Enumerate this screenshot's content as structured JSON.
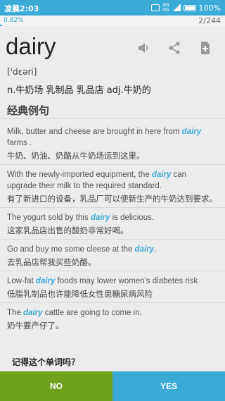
{
  "status": {
    "time": "凌晨2:03",
    "network": "4G",
    "network_sub": "3G",
    "battery": "100%"
  },
  "progress": {
    "percent_label": "0.82%",
    "fraction": 0.0082,
    "count": "2/244"
  },
  "word": {
    "text": "dairy",
    "phonetic": "['dɛəri]",
    "meaning": "n.牛奶场 乳制品 乳品店 adj.牛奶的"
  },
  "icons": {
    "speaker": "speaker-icon",
    "share": "share-icon",
    "add": "add-note-icon"
  },
  "section_title": "经典例句",
  "examples": [
    {
      "pre": "Milk, butter and cheese are brought in here from ",
      "kw": "dairy",
      "post": " farms .",
      "zh": "牛奶、奶油、奶酪从牛奶场运到这里。"
    },
    {
      "pre": "With the newly-imported equipment, the ",
      "kw": "dairy",
      "post": " can upgrade their milk to the required standard.",
      "zh": "有了新进口的设备，乳品厂可以使新生产的牛奶达到要求。"
    },
    {
      "pre": "The yogurt sold by this ",
      "kw": "dairy",
      "post": " is delicious.",
      "zh": "这家乳品店出售的酸奶非常好喝。"
    },
    {
      "pre": "Go and buy me some cleese at the ",
      "kw": "dairy",
      "post": ".",
      "zh": "去乳品店帮我买些奶酪。"
    },
    {
      "pre": "Low-fat ",
      "kw": "dairy",
      "post": " foods may lower women's diabetes risk",
      "zh": "低脂乳制品也许能降低女性患糖尿病风险"
    },
    {
      "pre": "The ",
      "kw": "dairy",
      "post": " cattle are going to come in.",
      "zh": "奶牛要产仔了。"
    }
  ],
  "remember_prompt": "记得这个单词吗？",
  "buttons": {
    "no": "NO",
    "yes": "YES"
  },
  "colors": {
    "accent": "#3aaad6",
    "no_button": "#6fa21c"
  }
}
